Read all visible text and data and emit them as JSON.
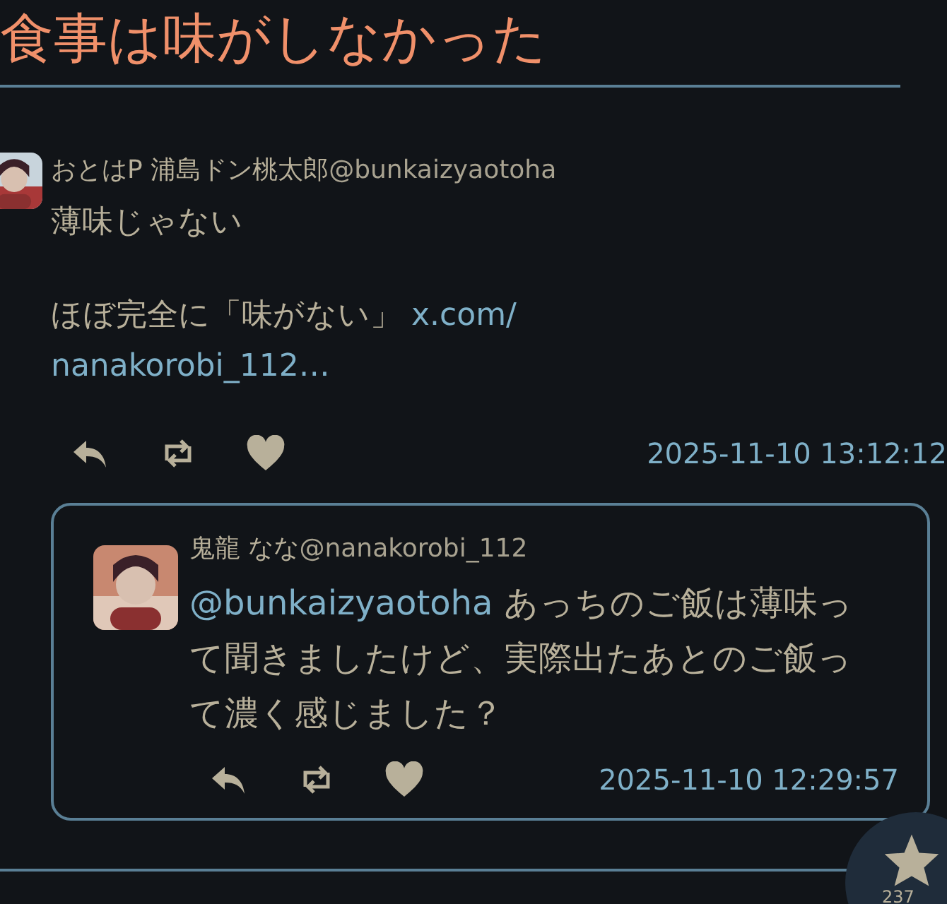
{
  "title": "食事は味がしなかった",
  "post": {
    "author": "おとはP 浦島ドン桃太郎",
    "handle": "@bunkaizyaotoha",
    "paragraphs": [
      {
        "text": "薄味じゃない"
      },
      {
        "text": "ほぼ完全に「味がない」",
        "link_lines": [
          "x.com/",
          "nanakorobi_112…"
        ]
      }
    ],
    "timestamp": "2025-11-10 13:12:12",
    "quote": {
      "author": "鬼龍 なな",
      "handle": "@nanakorobi_112",
      "mention": "@bunkaizyaotoha",
      "text": " あっちのご飯は薄味って聞きましたけど、実際出たあとのご飯って濃く感じました？",
      "timestamp": "2025-11-10 12:29:57"
    }
  },
  "fab": {
    "count": "237"
  }
}
